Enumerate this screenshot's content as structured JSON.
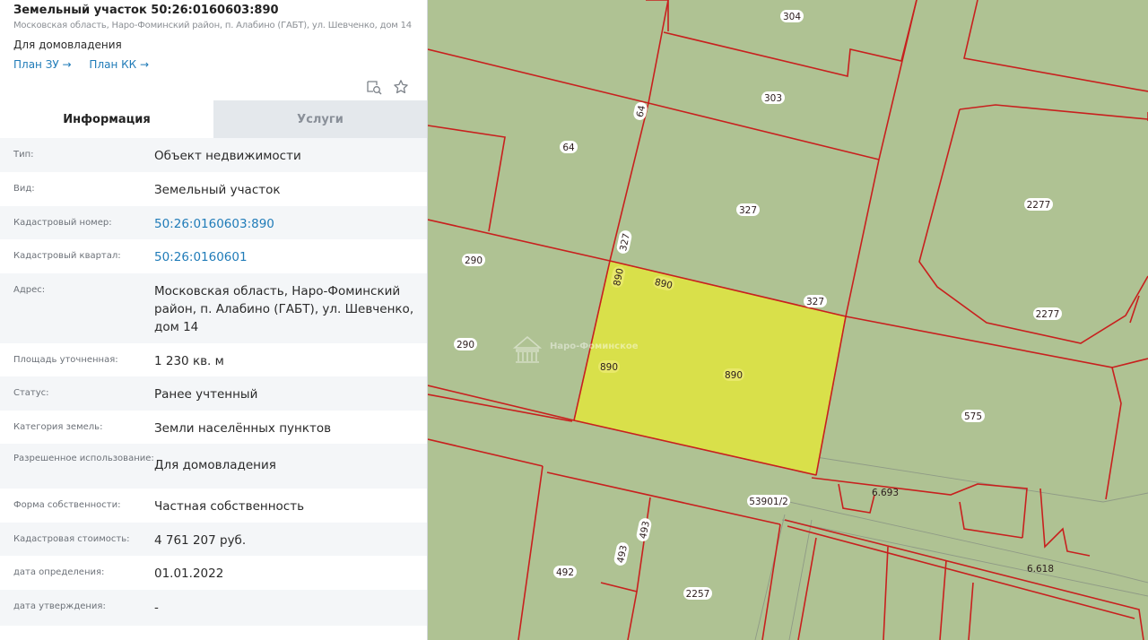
{
  "header": {
    "title": "Земельный участок 50:26:0160603:890",
    "address": "Московская область, Наро-Фоминский район, п. Алабино (ГАБТ), ул. Шевченко, дом 14",
    "purpose": "Для домовладения",
    "link_plan_zu": "План ЗУ →",
    "link_plan_kk": "План КК →"
  },
  "tabs": {
    "info": "Информация",
    "services": "Услуги"
  },
  "rows": [
    {
      "label": "Тип:",
      "value": "Объект недвижимости"
    },
    {
      "label": "Вид:",
      "value": "Земельный участок"
    },
    {
      "label": "Кадастровый номер:",
      "value": "50:26:0160603:890"
    },
    {
      "label": "Кадастровый квартал:",
      "value": "50:26:0160601"
    },
    {
      "label": "Адрес:",
      "value": "Московская область, Наро-Фоминский район, п. Алабино (ГАБТ), ул. Шевченко, дом 14"
    },
    {
      "label": "Площадь уточненная:",
      "value": "1 230 кв. м"
    },
    {
      "label": "Статус:",
      "value": "Ранее учтенный"
    },
    {
      "label": "Категория земель:",
      "value": "Земли населённых пунктов"
    },
    {
      "label": "Разрешенное использование:",
      "value": "Для домовладения"
    },
    {
      "label": "Форма собственности:",
      "value": "Частная собственность"
    },
    {
      "label": "Кадастровая стоимость:",
      "value": "4 761 207 руб."
    },
    {
      "label": "дата определения:",
      "value": "01.01.2022"
    },
    {
      "label": "дата утверждения:",
      "value": "-"
    }
  ],
  "map": {
    "labels": {
      "l304": "304",
      "l303": "303",
      "l64a": "64",
      "l64b": "64",
      "l327a": "327",
      "l327b": "327",
      "l327c": "327",
      "l2277a": "2277",
      "l2277b": "2277",
      "l290a": "290",
      "l290b": "290",
      "l890a": "890",
      "l890b": "890",
      "l890c": "890",
      "l890d": "890",
      "l575": "575",
      "l53901": "53901/2",
      "l6693": "6.693",
      "l6618": "6.618",
      "l492": "492",
      "l493a": "493",
      "l493b": "493",
      "l2257": "2257"
    },
    "watermark": "Наро-Фоминское",
    "colors": {
      "land": "#afc293",
      "boundary": "#c8201e",
      "selected": "#d9e04a"
    }
  }
}
